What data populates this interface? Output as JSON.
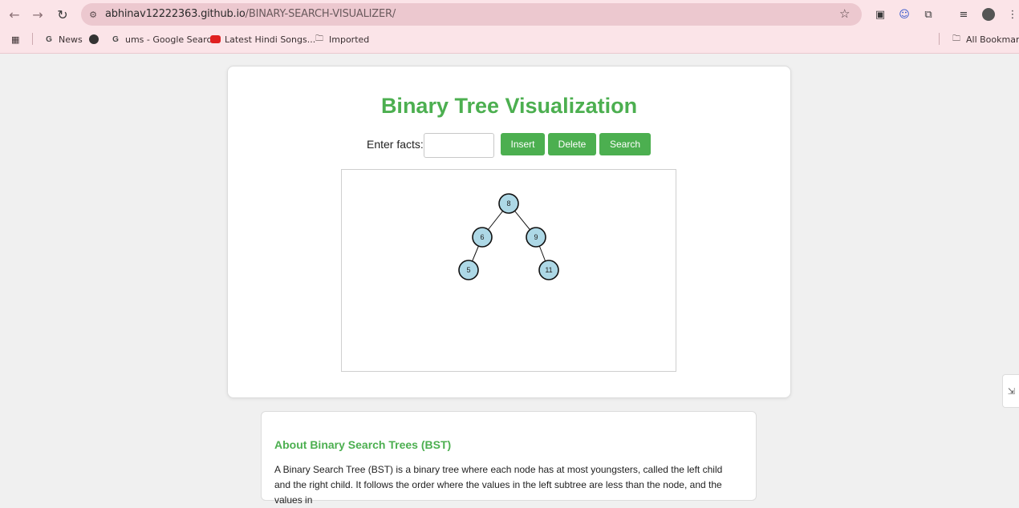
{
  "browser": {
    "url_host": "abhinav12222363.github.io",
    "url_path": "/BINARY-SEARCH-VISUALIZER/",
    "bookmarks": [
      {
        "label": "News",
        "icon": "google-icon"
      },
      {
        "label": "",
        "icon": "globe-icon"
      },
      {
        "label": "ums - Google Search",
        "icon": "google-icon"
      },
      {
        "label": "Latest Hindi Songs...",
        "icon": "youtube-icon"
      },
      {
        "label": "Imported",
        "icon": "folder-icon"
      }
    ],
    "all_bookmarks": "All Bookmarks"
  },
  "app": {
    "title": "Binary Tree Visualization",
    "input_label": "Enter facts:",
    "input_value": "",
    "buttons": {
      "insert": "Insert",
      "delete": "Delete",
      "search": "Search"
    },
    "accent_color": "#4caf50"
  },
  "tree": {
    "nodes": [
      {
        "id": "root",
        "value": "8",
        "parent": null
      },
      {
        "id": "left",
        "value": "6",
        "parent": "root"
      },
      {
        "id": "right",
        "value": "9",
        "parent": "root"
      },
      {
        "id": "left-left",
        "value": "5",
        "parent": "left"
      },
      {
        "id": "right-right",
        "value": "11",
        "parent": "right"
      }
    ],
    "node_fill": "#add8e6"
  },
  "about": {
    "title": "About Binary Search Trees (BST)",
    "text": "A Binary Search Tree (BST) is a binary tree where each node has at most youngsters, called the left child and the right child. It follows the order where the values in the left subtree are less than the node, and the values in"
  }
}
